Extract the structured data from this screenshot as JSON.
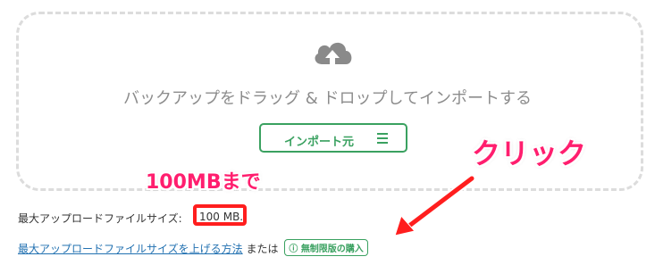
{
  "dropzone": {
    "icon": "cloud-upload-icon",
    "text": "バックアップをドラッグ & ドロップしてインポートする",
    "import_button": {
      "label": "インポート元",
      "icon": "menu-icon"
    }
  },
  "upload": {
    "max_label": "最大アップロードファイルサイズ:",
    "max_value": "100 MB.",
    "increase_link": "最大アップロードファイルサイズを上げる方法",
    "or_text": "または",
    "buy_badge": "無制限版の購入",
    "buy_icon": "info-circle-icon"
  },
  "annotations": {
    "size_note": "100MBまで",
    "click_note": "クリック",
    "color": "#ff1e6e"
  },
  "colors": {
    "accent": "#3aa160",
    "link": "#2271b1"
  }
}
